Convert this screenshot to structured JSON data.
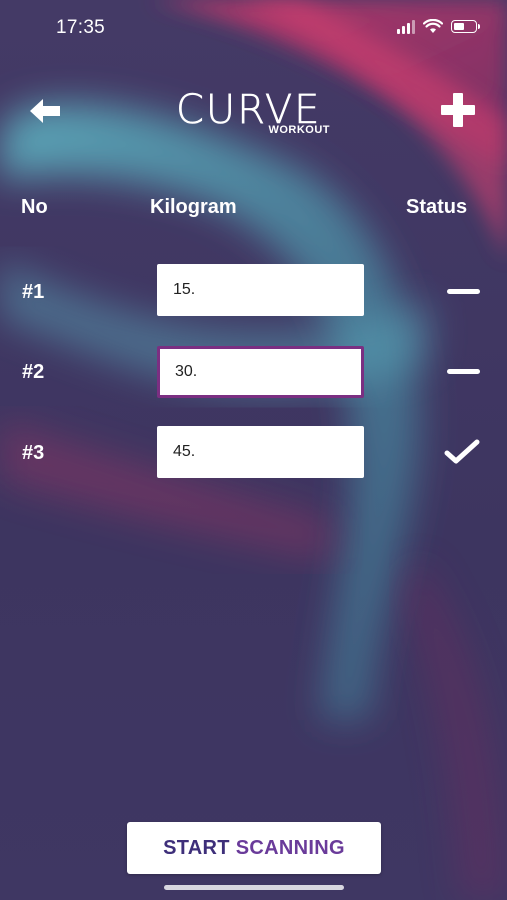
{
  "status_bar": {
    "time": "17:35",
    "icons": [
      "cellular-signal-icon",
      "wifi-icon",
      "battery-icon"
    ]
  },
  "header": {
    "back_icon": "arrow-left-icon",
    "add_icon": "plus-icon",
    "logo_text": "CURVE",
    "logo_subtext": "WORKOUT"
  },
  "table": {
    "headers": {
      "no": "No",
      "kilogram": "Kilogram",
      "status": "Status"
    },
    "rows": [
      {
        "no": "#1",
        "kilogram": "15.",
        "status": "pending",
        "status_icon": "minus-icon"
      },
      {
        "no": "#2",
        "kilogram": "30.",
        "status": "pending",
        "status_icon": "minus-icon",
        "focused": true
      },
      {
        "no": "#3",
        "kilogram": "45.",
        "status": "done",
        "status_icon": "checkmark-icon"
      }
    ]
  },
  "actions": {
    "start_label_1": "START",
    "start_label_2": "SCANNING"
  },
  "colors": {
    "background": "#3f3460",
    "accent_pink": "#c43a6e",
    "accent_teal": "#4aa3b8",
    "focus_border": "#7b2f82",
    "button_text_dark": "#3e2f7a",
    "button_text_purple": "#6a3b9a"
  }
}
